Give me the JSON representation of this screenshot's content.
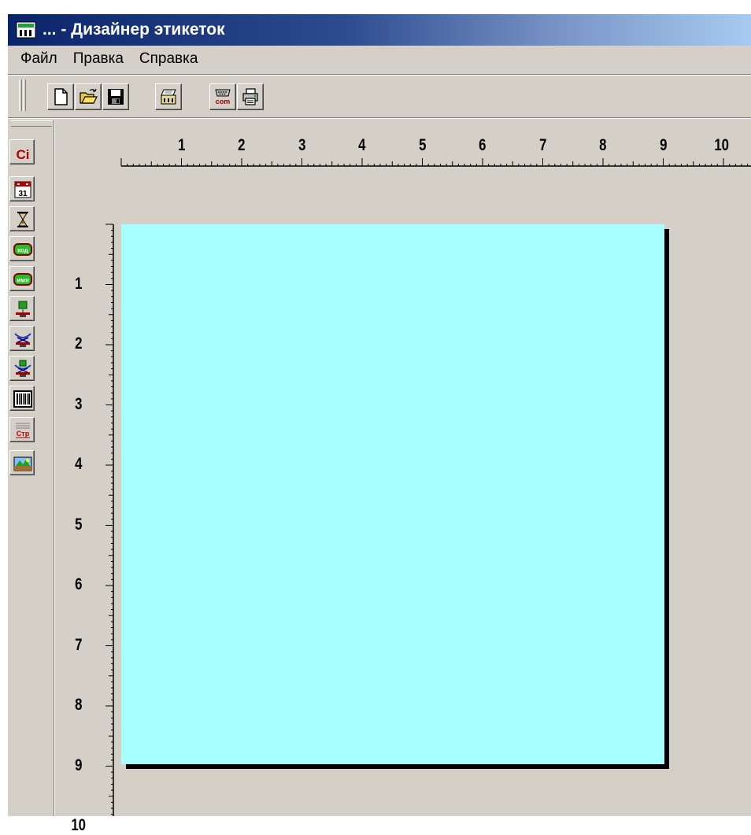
{
  "window": {
    "title": "... - Дизайнер этикеток",
    "title_icon": "printer-app-icon"
  },
  "menu": {
    "items": [
      "Файл",
      "Правка",
      "Справка"
    ]
  },
  "toolbar": {
    "buttons": [
      {
        "icon": "new-file-icon"
      },
      {
        "icon": "open-folder-icon"
      },
      {
        "icon": "save-disk-icon"
      },
      {
        "icon": "label-printer-icon"
      },
      {
        "icon": "com-port-icon",
        "text": "com"
      },
      {
        "icon": "print-icon"
      }
    ]
  },
  "side_tools": {
    "text_button": "Ci",
    "date_button": "31",
    "time_button_icon": "hourglass-icon",
    "code_button": "код",
    "name_button": "имя",
    "weight_button_icon": "scale-weight-icon",
    "tare_button_icon": "scale-tare-icon",
    "net_button_icon": "scale-net-icon",
    "barcode_button_icon": "barcode-icon",
    "line_button": "Стр",
    "image_button_icon": "image-icon"
  },
  "rulers": {
    "top_numbers": [
      "1",
      "2",
      "3",
      "4",
      "5",
      "6",
      "7",
      "8",
      "9",
      "10"
    ],
    "left_numbers": [
      "1",
      "2",
      "3",
      "4",
      "5",
      "6",
      "7",
      "8",
      "9",
      "10"
    ]
  },
  "colors": {
    "label_background": "#a8ffff",
    "window_face": "#d4d0c8",
    "titlebar_start": "#0a246a"
  }
}
